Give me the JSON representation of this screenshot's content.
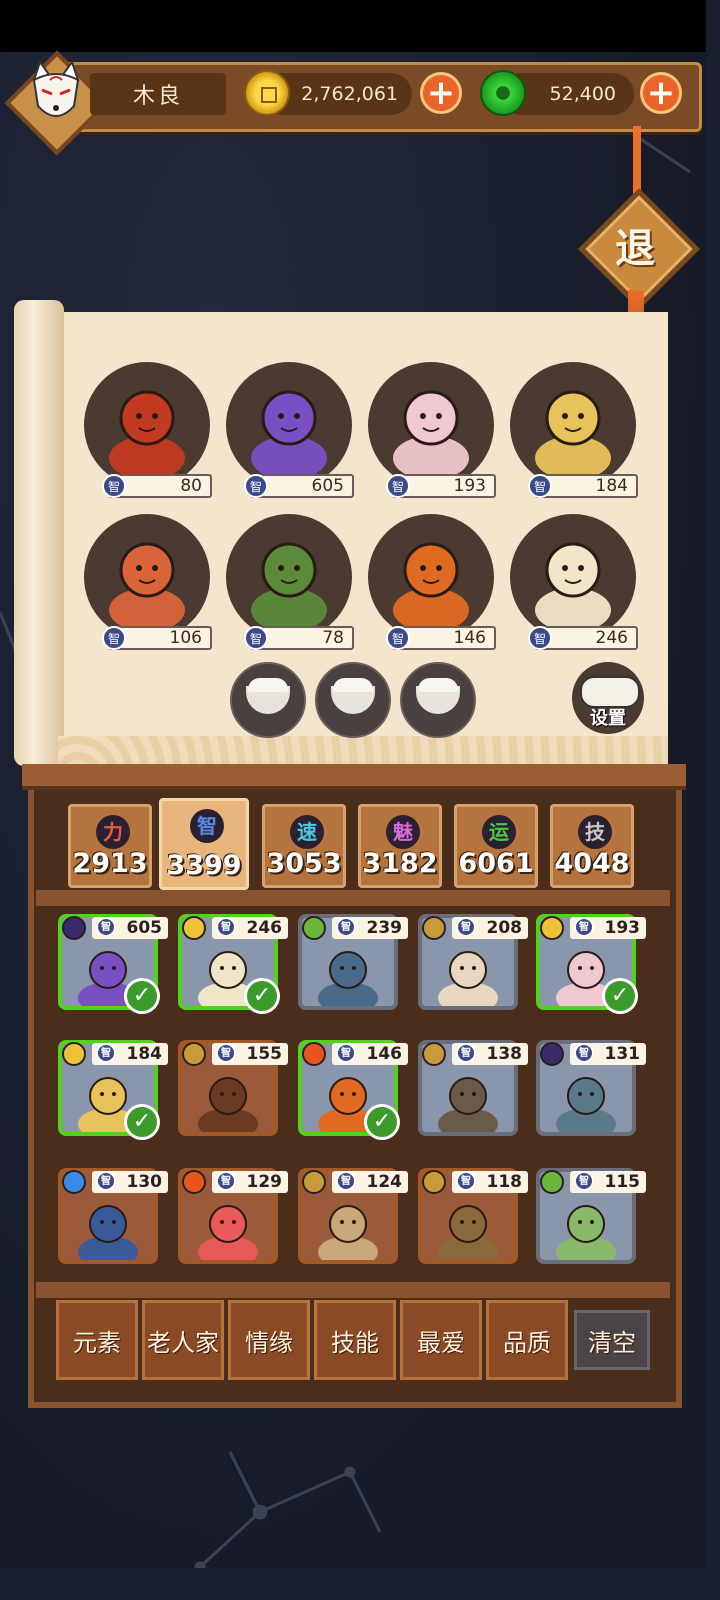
{
  "player": {
    "name": "木良"
  },
  "currency": {
    "coins": "2,762,061",
    "jade": "52,400"
  },
  "exit_label": "退",
  "settings_label": "设置",
  "attr_abbr": "智",
  "slots": [
    {
      "value": "80",
      "color": "#c23a22"
    },
    {
      "value": "605",
      "color": "#7a4fc4"
    },
    {
      "value": "193",
      "color": "#f0c8d0"
    },
    {
      "value": "184",
      "color": "#e8c25a"
    },
    {
      "value": "106",
      "color": "#d8643a"
    },
    {
      "value": "78",
      "color": "#5a8a3a"
    },
    {
      "value": "146",
      "color": "#e06a22"
    },
    {
      "value": "246",
      "color": "#f0e6c8"
    }
  ],
  "stats": [
    {
      "glyph": "力",
      "value": "2913",
      "color": "#e85a3a"
    },
    {
      "glyph": "智",
      "value": "3399",
      "color": "#5a8ae8"
    },
    {
      "glyph": "速",
      "value": "3053",
      "color": "#4ac8e8"
    },
    {
      "glyph": "魅",
      "value": "3182",
      "color": "#d86ad8"
    },
    {
      "glyph": "运",
      "value": "6061",
      "color": "#4ac84a"
    },
    {
      "glyph": "技",
      "value": "4048",
      "color": "#c8c8c8"
    }
  ],
  "roster": [
    {
      "value": "605",
      "element": "moon",
      "picked": true
    },
    {
      "value": "246",
      "element": "sun",
      "picked": true
    },
    {
      "value": "239",
      "element": "leaf",
      "picked": false
    },
    {
      "value": "208",
      "element": "earth",
      "picked": false
    },
    {
      "value": "193",
      "element": "sun",
      "picked": true
    },
    {
      "value": "184",
      "element": "sun",
      "picked": true
    },
    {
      "value": "155",
      "element": "earth",
      "picked": false
    },
    {
      "value": "146",
      "element": "fire",
      "picked": true
    },
    {
      "value": "138",
      "element": "earth",
      "picked": false
    },
    {
      "value": "131",
      "element": "moon",
      "picked": false
    },
    {
      "value": "130",
      "element": "water",
      "picked": false
    },
    {
      "value": "129",
      "element": "fire",
      "picked": false
    },
    {
      "value": "124",
      "element": "earth",
      "picked": false
    },
    {
      "value": "118",
      "element": "earth",
      "picked": false
    },
    {
      "value": "115",
      "element": "leaf",
      "picked": false
    }
  ],
  "filters": [
    "元素",
    "老人家",
    "情缘",
    "技能",
    "最爱",
    "品质"
  ],
  "clear_label": "清空"
}
